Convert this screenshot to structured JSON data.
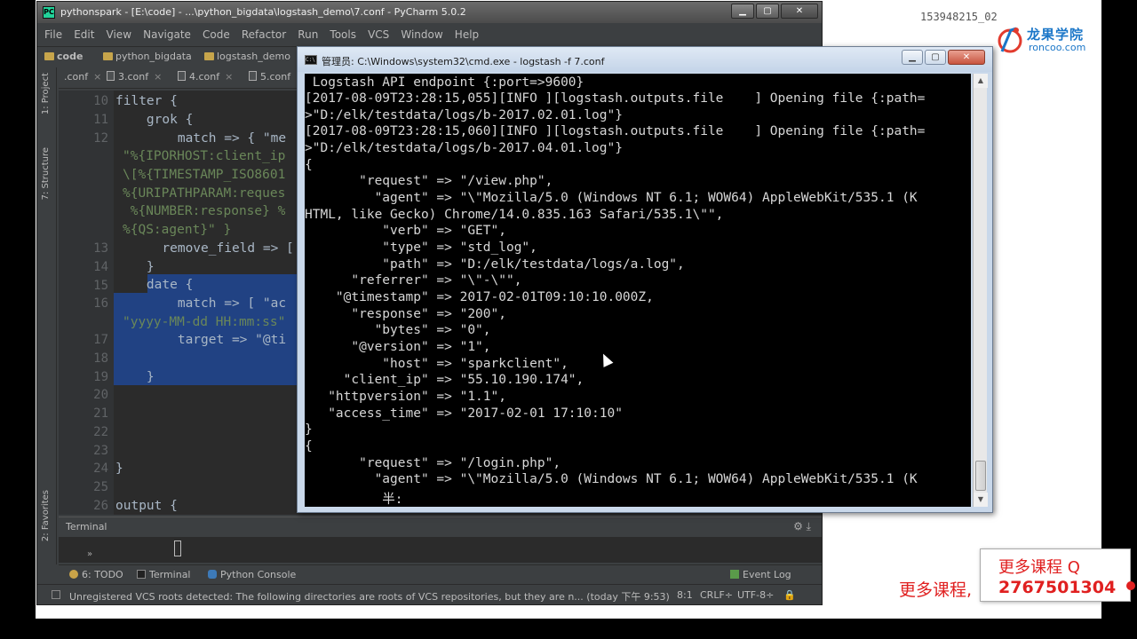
{
  "overlay": {
    "video_id": "153948215_02",
    "logo_cn": "龙果学院",
    "logo_en": "roncoo.com",
    "promo_left": "更多课程,",
    "promo_line1": "更多课程 Q",
    "promo_line2": "2767501304"
  },
  "pycharm": {
    "title": "pythonspark - [E:\\code] - ...\\python_bigdata\\logstash_demo\\7.conf - PyCharm 5.0.2",
    "app_icon_text": "PC",
    "menu": [
      "File",
      "Edit",
      "View",
      "Navigate",
      "Code",
      "Refactor",
      "Run",
      "Tools",
      "VCS",
      "Window",
      "Help"
    ],
    "breadcrumbs": [
      "code",
      "python_bigdata",
      "logstash_demo"
    ],
    "tabs": [
      ".conf",
      "3.conf",
      "4.conf",
      "5.conf"
    ],
    "side_labels": [
      "1: Project",
      "7: Structure",
      "2: Favorites"
    ],
    "line_numbers": [
      "10",
      "11",
      "12",
      "",
      "",
      "",
      "",
      "13",
      "14",
      "15",
      "16",
      "",
      "17",
      "18",
      "19",
      "20",
      "21",
      "22",
      "23",
      "24",
      "25",
      "26"
    ],
    "code_lines": [
      "filter {",
      "    grok {",
      "        match => { \"me",
      "\"%{IPORHOST:client_ip",
      "\\[%{TIMESTAMP_ISO8601",
      "%{URIPATHPARAM:reques",
      " %{NUMBER:response} %",
      "%{QS:agent}\" }",
      "      remove_field => [",
      "    }",
      "    date {",
      "        match => [ \"ac",
      "\"yyyy-MM-dd HH:mm:ss\"",
      "        target => \"@ti",
      "",
      "    }",
      "",
      "",
      "",
      "",
      "}",
      "",
      "output {"
    ],
    "terminal_title": "Terminal",
    "terminal_tools": "⚙ ⤓",
    "toolwindows": [
      "6: TODO",
      "Terminal",
      "Python Console",
      "Event Log"
    ],
    "status_msg": "Unregistered VCS roots detected: The following directories are roots of VCS repositories, but they are n... (today 下午 9:53)",
    "status_pos": "8:1",
    "status_crlf": "CRLF÷",
    "status_enc": "UTF-8÷"
  },
  "cmd": {
    "title": "管理员: C:\\Windows\\system32\\cmd.exe - logstash  -f 7.conf",
    "icon_text": "C:\\",
    "lines": [
      " Logstash API endpoint {:port=>9600}",
      "[2017-08-09T23:28:15,055][INFO ][logstash.outputs.file    ] Opening file {:path=",
      ">\"D:/elk/testdata/logs/b-2017.02.01.log\"}",
      "[2017-08-09T23:28:15,060][INFO ][logstash.outputs.file    ] Opening file {:path=",
      ">\"D:/elk/testdata/logs/b-2017.04.01.log\"}",
      "{",
      "       \"request\" => \"/view.php\",",
      "         \"agent\" => \"\\\"Mozilla/5.0 (Windows NT 6.1; WOW64) AppleWebKit/535.1 (K",
      "HTML, like Gecko) Chrome/14.0.835.163 Safari/535.1\\\"\",",
      "          \"verb\" => \"GET\",",
      "          \"type\" => \"std_log\",",
      "          \"path\" => \"D:/elk/testdata/logs/a.log\",",
      "      \"referrer\" => \"\\\"-\\\"\",",
      "    \"@timestamp\" => 2017-02-01T09:10:10.000Z,",
      "      \"response\" => \"200\",",
      "         \"bytes\" => \"0\",",
      "      \"@version\" => \"1\",",
      "          \"host\" => \"sparkclient\",",
      "     \"client_ip\" => \"55.10.190.174\",",
      "   \"httpversion\" => \"1.1\",",
      "   \"access_time\" => \"2017-02-01 17:10:10\"",
      "}",
      "{",
      "       \"request\" => \"/login.php\",",
      "         \"agent\" => \"\\\"Mozilla/5.0 (Windows NT 6.1; WOW64) AppleWebKit/535.1 (K",
      "          半:"
    ]
  }
}
